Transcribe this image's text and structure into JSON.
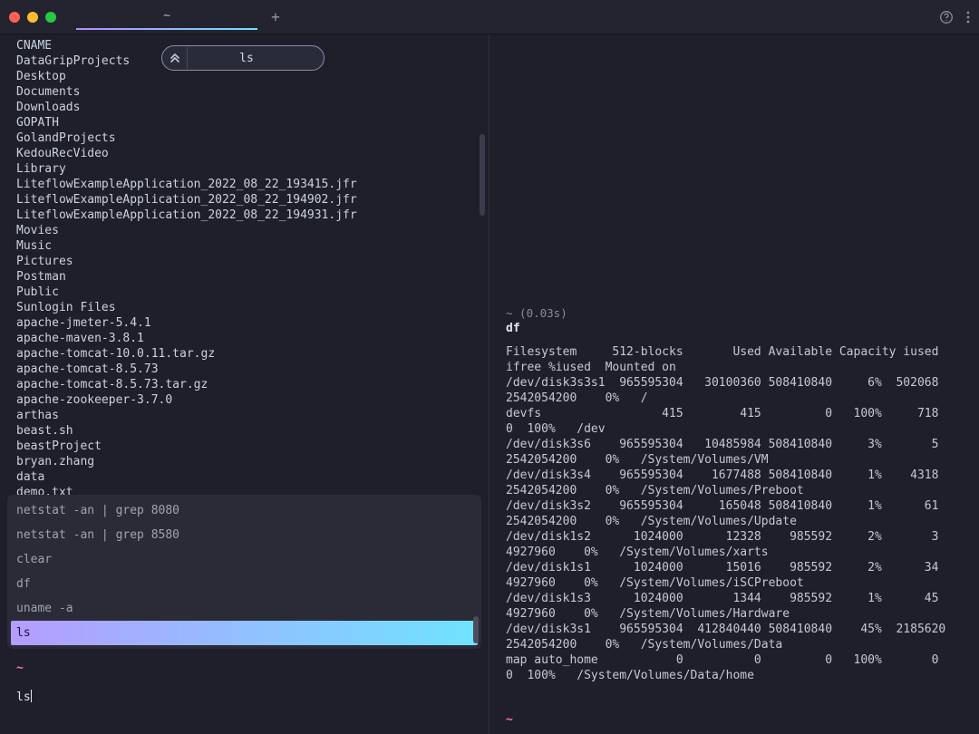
{
  "titlebar": {
    "tab_label": "~",
    "new_tab_glyph": "+"
  },
  "suggest": {
    "label": "ls"
  },
  "listing": [
    "CNAME",
    "DataGripProjects",
    "Desktop",
    "Documents",
    "Downloads",
    "GOPATH",
    "GolandProjects",
    "KedouRecVideo",
    "Library",
    "LiteflowExampleApplication_2022_08_22_193415.jfr",
    "LiteflowExampleApplication_2022_08_22_194902.jfr",
    "LiteflowExampleApplication_2022_08_22_194931.jfr",
    "Movies",
    "Music",
    "Pictures",
    "Postman",
    "Public",
    "Sunlogin Files",
    "apache-jmeter-5.4.1",
    "apache-maven-3.8.1",
    "apache-tomcat-10.0.11.tar.gz",
    "apache-tomcat-8.5.73",
    "apache-tomcat-8.5.73.tar.gz",
    "apache-zookeeper-3.7.0",
    "arthas",
    "beast.sh",
    "beastProject",
    "bryan.zhang",
    "data",
    "demo.txt"
  ],
  "history": [
    {
      "cmd": "netstat -an | grep 8080",
      "selected": false
    },
    {
      "cmd": "netstat -an | grep 8580",
      "selected": false
    },
    {
      "cmd": "clear",
      "selected": false
    },
    {
      "cmd": "df",
      "selected": false
    },
    {
      "cmd": "uname -a",
      "selected": false
    },
    {
      "cmd": "ls",
      "selected": true
    }
  ],
  "prompt": {
    "cwd_symbol": "~",
    "typed": "ls"
  },
  "right": {
    "timing": "~ (0.03s)",
    "command": "df",
    "output_lines": [
      "Filesystem     512-blocks       Used Available Capacity iused      ifree %iused  Mounted on",
      "/dev/disk3s3s1  965595304   30100360 508410840     6%  502068 2542054200    0%   /",
      "devfs                 415        415         0   100%     718          0  100%   /dev",
      "/dev/disk3s6    965595304   10485984 508410840     3%       5 2542054200    0%   /System/Volumes/VM",
      "/dev/disk3s4    965595304    1677488 508410840     1%    4318 2542054200    0%   /System/Volumes/Preboot",
      "/dev/disk3s2    965595304     165048 508410840     1%      61 2542054200    0%   /System/Volumes/Update",
      "/dev/disk1s2      1024000      12328    985592     2%       3    4927960    0%   /System/Volumes/xarts",
      "/dev/disk1s1      1024000      15016    985592     2%      34    4927960    0%   /System/Volumes/iSCPreboot",
      "/dev/disk1s3      1024000       1344    985592     1%      45    4927960    0%   /System/Volumes/Hardware",
      "/dev/disk3s1    965595304  412840440 508410840    45%  2185620 2542054200    0%   /System/Volumes/Data",
      "map auto_home           0          0         0   100%       0          0  100%   /System/Volumes/Data/home"
    ],
    "prompt_symbol": "~"
  }
}
